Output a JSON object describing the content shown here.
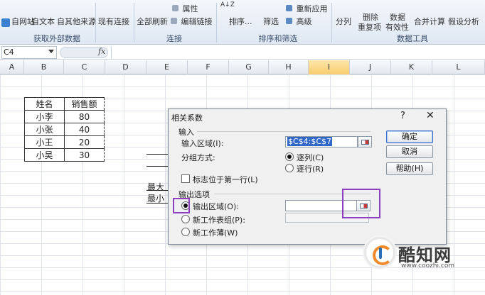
{
  "ribbon": {
    "buttons": {
      "from_web": "自网站",
      "from_text": "自文本",
      "from_other": "自其他来源",
      "existing_conn": "现有连接",
      "refresh_all": "全部刷新",
      "properties": "属性",
      "edit_links": "编辑链接",
      "sort": "排序...",
      "filter": "筛选",
      "reapply": "重新应用",
      "advanced": "高级",
      "text_to_columns": "分列",
      "remove_duplicates_1": "删除",
      "remove_duplicates_2": "重复项",
      "validation_1": "数据",
      "validation_2": "有效性",
      "consolidate": "合并计算",
      "what_if": "假设分析"
    },
    "groups": {
      "get_external": "获取外部数据",
      "connections": "连接",
      "sort_filter": "排序和筛选",
      "data_tools": "数据工具"
    },
    "sort_az": "A↓Z"
  },
  "formula_bar": {
    "name_box": "C4",
    "fx": "fx"
  },
  "columns": [
    "A",
    "B",
    "C",
    "D",
    "E",
    "F",
    "G",
    "H",
    "I",
    "J",
    "K",
    "L"
  ],
  "table": {
    "headers": [
      "姓名",
      "销售额"
    ],
    "rows": [
      [
        "小李",
        "80"
      ],
      [
        "小张",
        "40"
      ],
      [
        "小王",
        "20"
      ],
      [
        "小吴",
        "30"
      ]
    ]
  },
  "behind_text": {
    "max": "最大",
    "min": "最小"
  },
  "dialog": {
    "title": "相关系数",
    "help": "?",
    "close": "✕",
    "input_section": "输入",
    "input_range_label": "输入区域(I):",
    "input_range_value": "$C$4:$C$7",
    "group_by_label": "分组方式:",
    "by_column": "逐列(C)",
    "by_row": "逐行(R)",
    "labels_first_row": "标志位于第一行(L)",
    "output_section": "输出选项",
    "output_range": "输出区域(O):",
    "new_worksheet": "新工作表组(P):",
    "new_workbook": "新工作薄(W)",
    "ok": "确定",
    "cancel": "取消",
    "help_button": "帮助(H)"
  },
  "watermark": {
    "name": "酷知网",
    "url": "www.coozhi.com"
  },
  "colors": {
    "highlight": "#8e3fbf",
    "selected_column": "#f8cd6e",
    "ribbon_bg": "#dfe8f3"
  }
}
